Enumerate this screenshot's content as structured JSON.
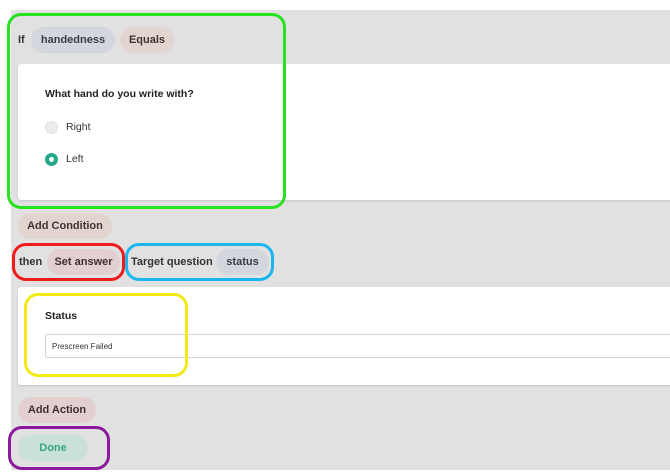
{
  "condition": {
    "if_label": "If",
    "field_chip": "handedness",
    "operator_chip": "Equals",
    "question": "What hand do you write with?",
    "options": [
      "Right",
      "Left"
    ],
    "selected_option": "Left"
  },
  "add_condition_label": "Add Condition",
  "action": {
    "then_label": "then",
    "action_chip": "Set answer",
    "target_label": "Target question",
    "target_chip": "status"
  },
  "status_field": {
    "label": "Status",
    "value": "Prescreen Failed"
  },
  "add_action_label": "Add Action",
  "done_label": "Done",
  "colors": {
    "panel_bg": "#e1e1e1",
    "accent_green": "#25a88a",
    "highlight_green": "#26e21f",
    "highlight_red": "#ee1c1c",
    "highlight_blue": "#1ab7ee",
    "highlight_yellow": "#f2ea14",
    "highlight_purple": "#8b1a9b"
  }
}
